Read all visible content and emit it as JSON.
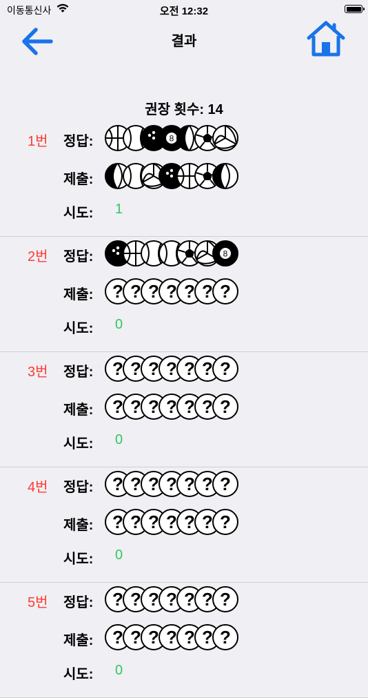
{
  "status": {
    "carrier": "이동통신사",
    "time": "오전 12:32"
  },
  "nav": {
    "title": "결과"
  },
  "recommended": "권장 횟수: 14",
  "labels": {
    "answer": "정답:",
    "submit": "제출:",
    "attempts": "시도:"
  },
  "rounds": [
    {
      "num": "1번",
      "attempts": "1",
      "answer": [
        "basketball",
        "baseball",
        "bowling",
        "eightball",
        "volleyball-dark",
        "soccer",
        "volleyball"
      ],
      "submit": [
        "volleyball-dark",
        "baseball",
        "volleyball",
        "bowling",
        "basketball",
        "soccer",
        "volleyball-dark"
      ]
    },
    {
      "num": "2번",
      "attempts": "0",
      "answer": [
        "bowling",
        "basketball",
        "baseball",
        "baseball",
        "soccer",
        "volleyball",
        "eightball"
      ],
      "submit": [
        "unknown",
        "unknown",
        "unknown",
        "unknown",
        "unknown",
        "unknown",
        "unknown"
      ]
    },
    {
      "num": "3번",
      "attempts": "0",
      "answer": [
        "unknown",
        "unknown",
        "unknown",
        "unknown",
        "unknown",
        "unknown",
        "unknown"
      ],
      "submit": [
        "unknown",
        "unknown",
        "unknown",
        "unknown",
        "unknown",
        "unknown",
        "unknown"
      ]
    },
    {
      "num": "4번",
      "attempts": "0",
      "answer": [
        "unknown",
        "unknown",
        "unknown",
        "unknown",
        "unknown",
        "unknown",
        "unknown"
      ],
      "submit": [
        "unknown",
        "unknown",
        "unknown",
        "unknown",
        "unknown",
        "unknown",
        "unknown"
      ]
    },
    {
      "num": "5번",
      "attempts": "0",
      "answer": [
        "unknown",
        "unknown",
        "unknown",
        "unknown",
        "unknown",
        "unknown",
        "unknown"
      ],
      "submit": [
        "unknown",
        "unknown",
        "unknown",
        "unknown",
        "unknown",
        "unknown",
        "unknown"
      ]
    }
  ],
  "colors": {
    "accent": "#1a73e8",
    "roundNumber": "#ff3b30",
    "attempts": "#34c759",
    "background": "#efeff4"
  }
}
